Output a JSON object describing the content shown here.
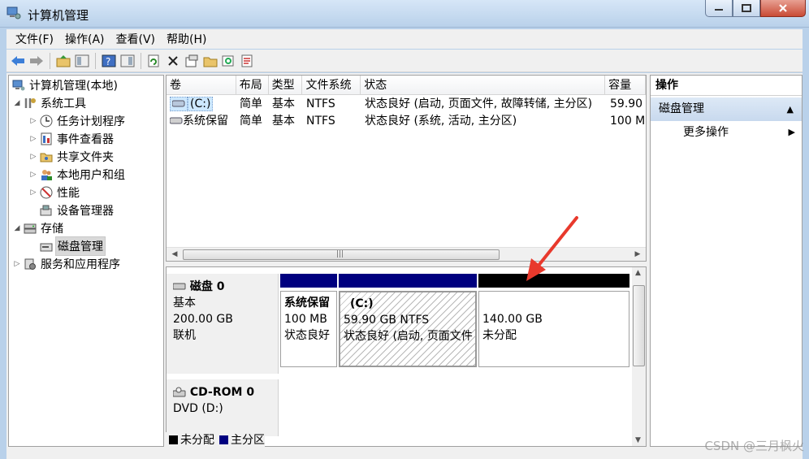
{
  "window": {
    "title": "计算机管理"
  },
  "menu": [
    "文件(F)",
    "操作(A)",
    "查看(V)",
    "帮助(H)"
  ],
  "tree": {
    "root": "计算机管理(本地)",
    "system_tools": "系统工具",
    "task_scheduler": "任务计划程序",
    "event_viewer": "事件查看器",
    "shared_folders": "共享文件夹",
    "local_users": "本地用户和组",
    "performance": "性能",
    "device_manager": "设备管理器",
    "storage": "存储",
    "disk_management": "磁盘管理",
    "services": "服务和应用程序"
  },
  "volumes": {
    "headers": [
      "卷",
      "布局",
      "类型",
      "文件系统",
      "状态",
      "容量"
    ],
    "rows": [
      {
        "name": "(C:)",
        "layout": "简单",
        "type": "基本",
        "fs": "NTFS",
        "status": "状态良好 (启动, 页面文件, 故障转储, 主分区)",
        "capacity": "59.90"
      },
      {
        "name": "系统保留",
        "layout": "简单",
        "type": "基本",
        "fs": "NTFS",
        "status": "状态良好 (系统, 活动, 主分区)",
        "capacity": "100 M"
      }
    ]
  },
  "disks": [
    {
      "name": "磁盘 0",
      "kind": "基本",
      "size": "200.00 GB",
      "state": "联机",
      "partitions": [
        {
          "title": "系统保留",
          "size": "100 MB",
          "status": "状态良好",
          "bar": "#00007f"
        },
        {
          "title": "(C:)",
          "size": "59.90 GB NTFS",
          "status": "状态良好 (启动, 页面文件",
          "bar": "#00007f"
        },
        {
          "title": "",
          "size": "140.00 GB",
          "status": "未分配",
          "bar": "#000000"
        }
      ]
    },
    {
      "name": "CD-ROM 0",
      "kind": "DVD (D:)"
    }
  ],
  "legend": {
    "unallocated": "未分配",
    "primary": "主分区"
  },
  "actions": {
    "header": "操作",
    "section": "磁盘管理",
    "more": "更多操作"
  },
  "watermark": "CSDN @三月枫火",
  "colors": {
    "primary": "#00007f",
    "unallocated": "#000000",
    "annotation": "#e8392c"
  }
}
